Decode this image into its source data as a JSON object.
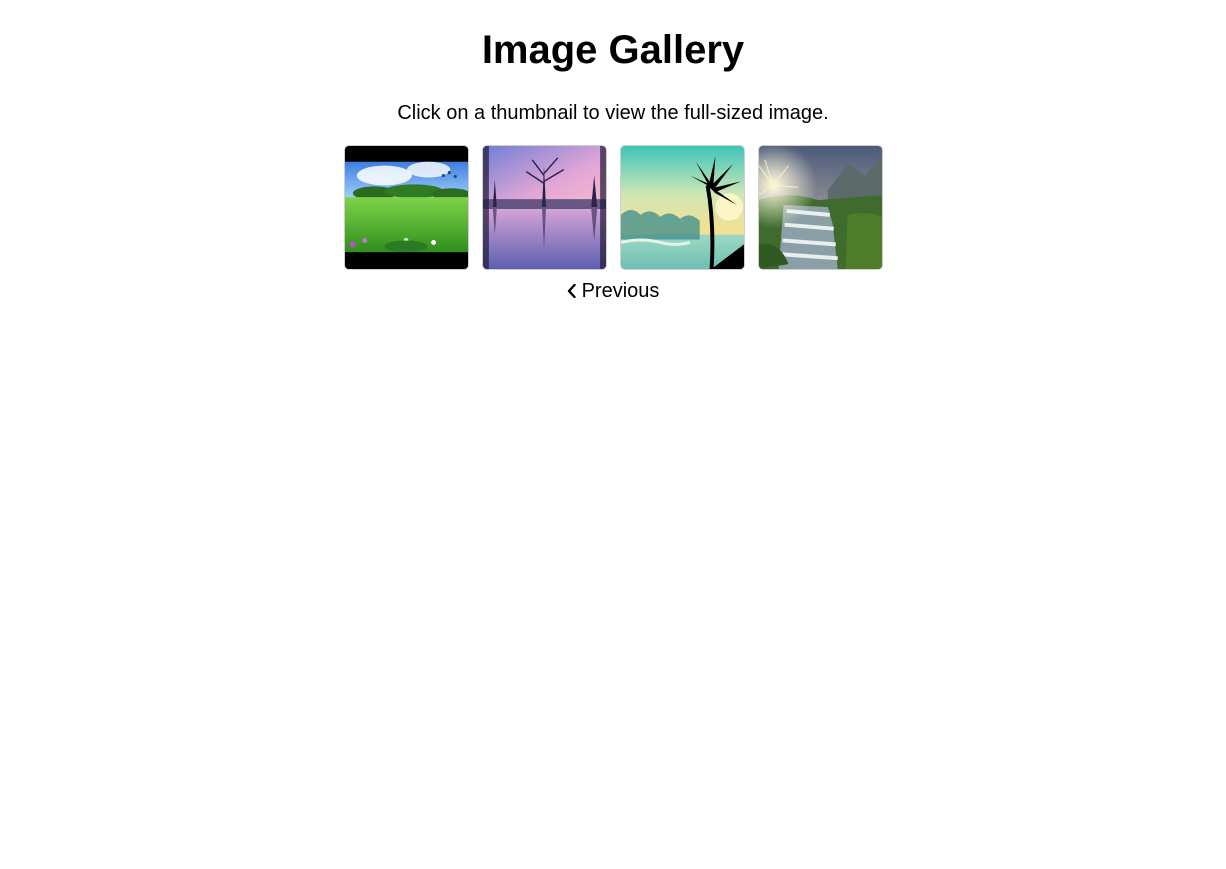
{
  "header": {
    "title": "Image Gallery",
    "subtitle": "Click on a thumbnail to view the full-sized image."
  },
  "gallery": {
    "thumbnails": [
      {
        "name": "meadow",
        "depicts": "green meadow with blue sky, flowers and birds"
      },
      {
        "name": "lake",
        "depicts": "pink-purple sunset lake reflection with trees"
      },
      {
        "name": "palms",
        "depicts": "tropical palm tree silhouettes at sunrise over water"
      },
      {
        "name": "waterfall",
        "depicts": "cascading waterfall with sunburst and mountains"
      }
    ]
  },
  "nav": {
    "previous_label": "Previous",
    "previous_icon": "chevron-left-icon"
  }
}
